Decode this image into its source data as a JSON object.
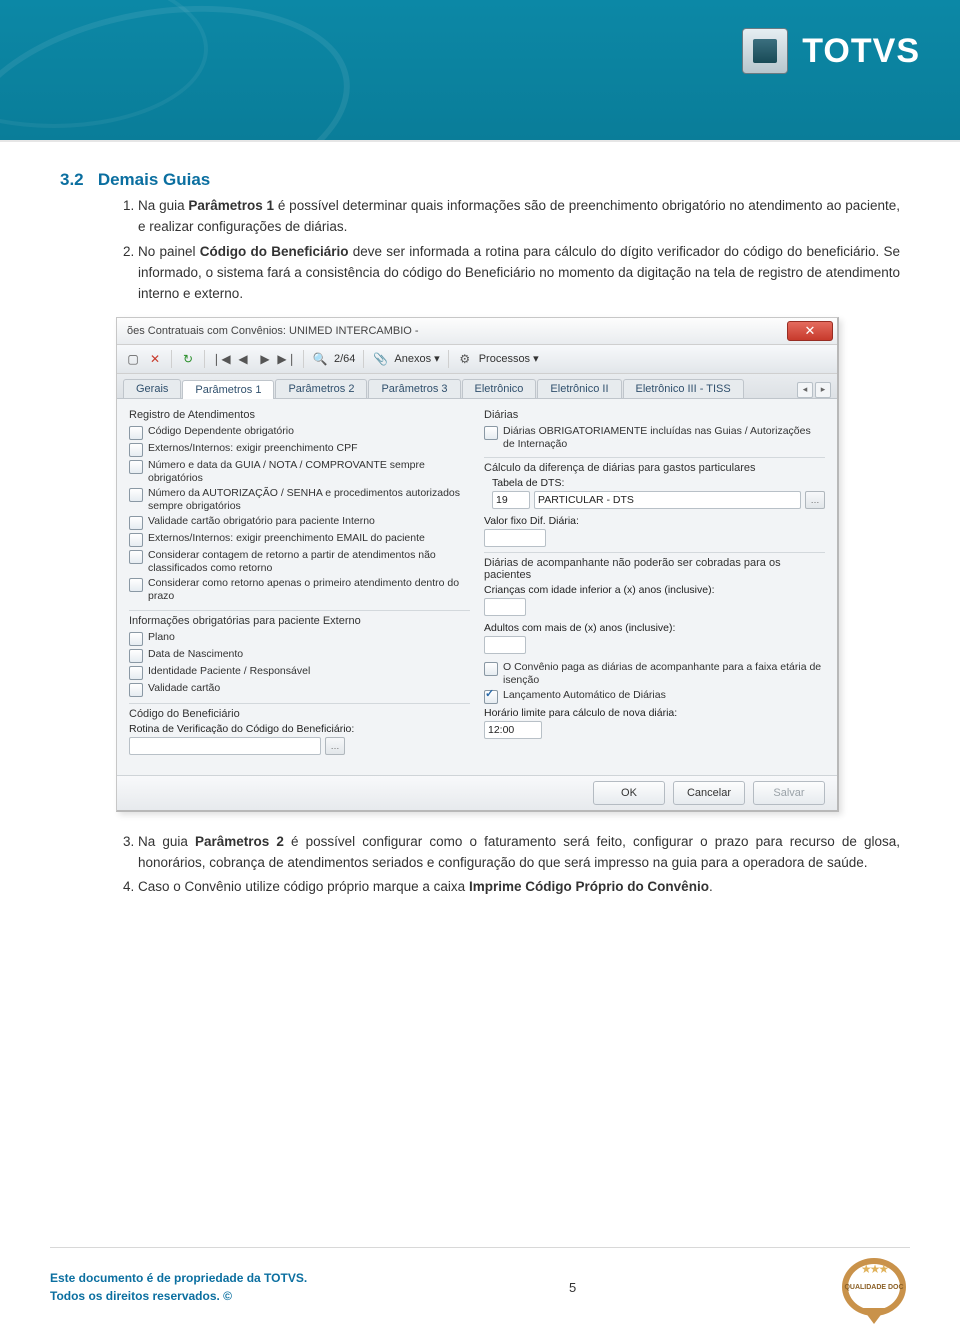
{
  "header": {
    "brand": "TOTVS"
  },
  "section": {
    "number": "3.2",
    "title": "Demais Guias",
    "items_a": [
      {
        "n": "1.",
        "pre": "Na guia ",
        "bold": "Parâmetros 1",
        "post": " é possível determinar quais informações são de preenchimento obrigatório no atendimento ao paciente, e realizar configurações de diárias."
      },
      {
        "n": "2.",
        "pre": "No painel ",
        "bold": "Código do Beneficiário",
        "post": " deve ser informada a rotina para cálculo do dígito verificador do código do beneficiário. Se informado, o sistema fará a consistência do código do Beneficiário no momento da digitação na tela de registro de atendimento interno e externo."
      }
    ],
    "items_b": [
      {
        "n": "3.",
        "pre": "Na guia ",
        "bold": "Parâmetros 2",
        "post": " é possível configurar como o faturamento será feito, configurar o prazo para recurso de glosa, honorários, cobrança de atendimentos seriados e configuração do que será impresso na guia para a operadora de saúde."
      },
      {
        "n": "4.",
        "pre": "Caso o Convênio utilize código próprio marque a caixa ",
        "bold": "Imprime Código Próprio do Convênio",
        "post": "."
      }
    ]
  },
  "app": {
    "title": "ões Contratuais com Convênios: UNIMED INTERCAMBIO -",
    "toolbar": {
      "record": "2/64",
      "anexos": "Anexos",
      "processos": "Processos"
    },
    "tabs": [
      "Gerais",
      "Parâmetros 1",
      "Parâmetros 2",
      "Parâmetros 3",
      "Eletrônico",
      "Eletrônico II",
      "Eletrônico III - TISS"
    ],
    "left": {
      "registro_title": "Registro de Atendimentos",
      "checks": [
        "Código Dependente obrigatório",
        "Externos/Internos: exigir preenchimento CPF",
        "Número e data da GUIA / NOTA / COMPROVANTE sempre obrigatórios",
        "Número da AUTORIZAÇÃO / SENHA e procedimentos autorizados sempre obrigatórios",
        "Validade cartão obrigatório para paciente Interno",
        "Externos/Internos: exigir preenchimento EMAIL do paciente",
        "Considerar contagem de retorno a partir de atendimentos não classificados como retorno",
        "Considerar como retorno apenas o primeiro atendimento dentro do prazo"
      ],
      "info_title": "Informações obrigatórias para paciente Externo",
      "info_checks": [
        "Plano",
        "Data de Nascimento",
        "Identidade Paciente / Responsável",
        "Validade cartão"
      ],
      "benef_title": "Código do Beneficiário",
      "benef_label": "Rotina de Verificação do Código do Beneficiário:"
    },
    "right": {
      "diarias_title": "Diárias",
      "chk_obrig": "Diárias OBRIGATORIAMENTE incluídas nas Guias / Autorizações de Internação",
      "calc_label": "Cálculo da diferença de diárias para gastos particulares",
      "tabela_label": "Tabela de DTS:",
      "tabela_code": "19",
      "tabela_desc": "PARTICULAR - DTS",
      "valor_label": "Valor fixo Dif. Diária:",
      "acomp_label": "Diárias de acompanhante não poderão ser cobradas para os pacientes",
      "criancas_label": "Crianças com idade inferior a (x) anos (inclusive):",
      "adultos_label": "Adultos com mais de (x) anos (inclusive):",
      "chk_convenio": "O Convênio paga as diárias de acompanhante para a faixa etária de isenção",
      "chk_lanc": "Lançamento Automático de Diárias",
      "horario_label": "Horário limite para cálculo de nova diária:",
      "horario_value": "12:00"
    },
    "buttons": {
      "ok": "OK",
      "cancelar": "Cancelar",
      "salvar": "Salvar"
    }
  },
  "footer": {
    "line1": "Este documento é de propriedade da TOTVS.",
    "line2": "Todos os direitos reservados. ©",
    "page": "5",
    "stamp": "QUALIDADE DOC"
  }
}
